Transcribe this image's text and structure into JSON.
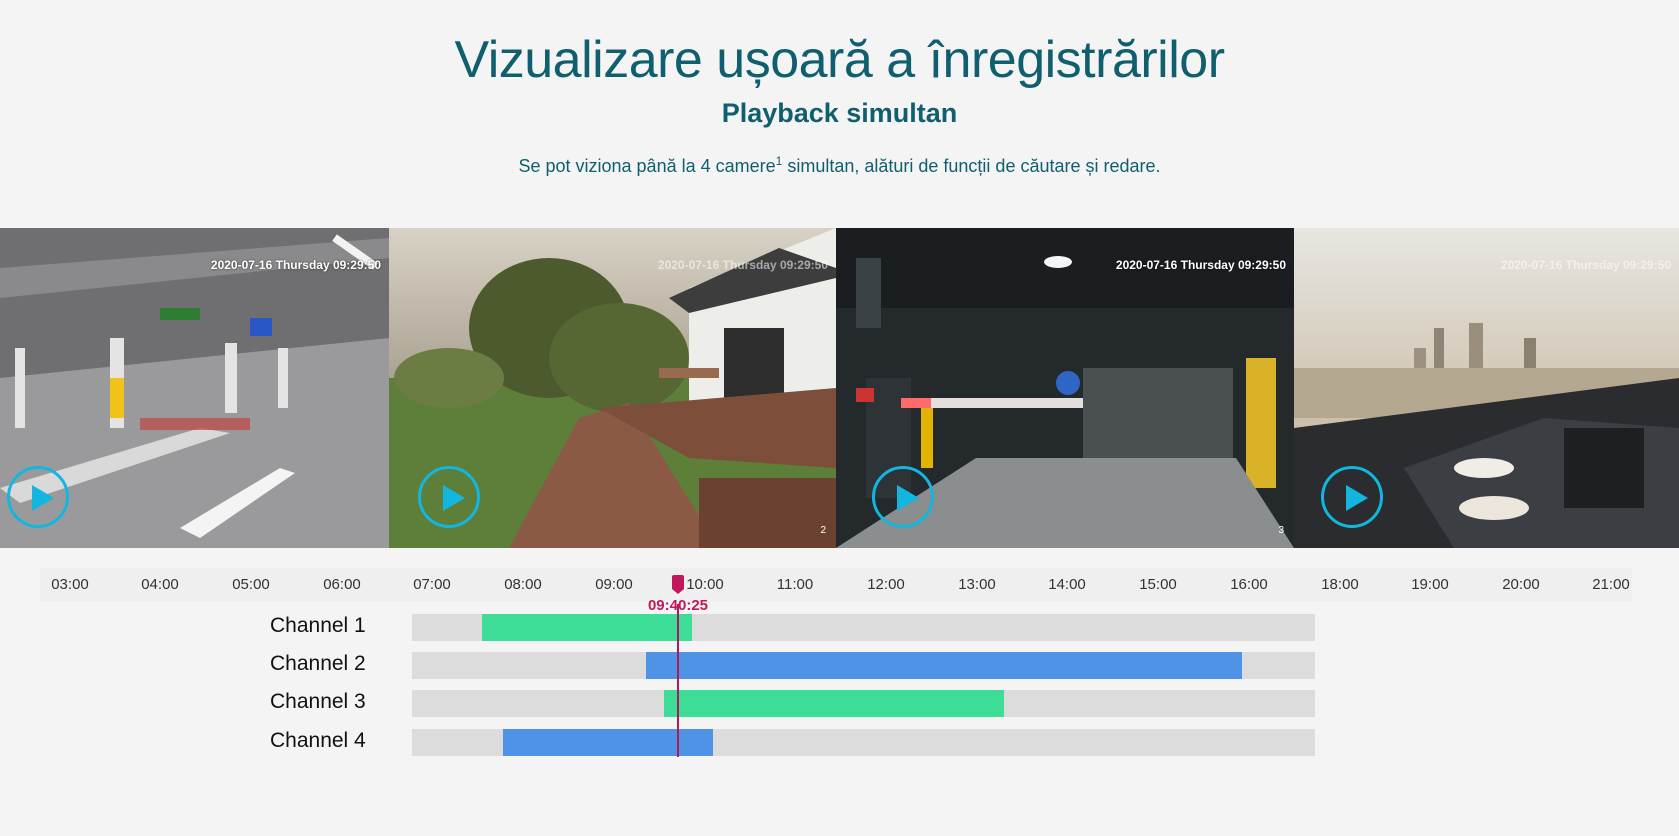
{
  "header": {
    "title": "Vizualizare ușoară a înregistrărilor",
    "subtitle": "Playback simultan",
    "desc_before": "Se pot viziona până la 4 camere",
    "desc_sup": "1",
    "desc_after": " simultan, alături de funcții de căutare și redare."
  },
  "cameras": [
    {
      "timestamp": "2020-07-16  Thursday 09:29:50",
      "number": ""
    },
    {
      "timestamp": "2020-07-16  Thursday 09:29:50",
      "number": "2"
    },
    {
      "timestamp": "2020-07-16  Thursday 09:29:50",
      "number": "3"
    },
    {
      "timestamp": "2020-07-16  Thursday 09:29:50",
      "number": ""
    }
  ],
  "timeline": {
    "ticks": [
      "03:00",
      "04:00",
      "05:00",
      "06:00",
      "07:00",
      "08:00",
      "09:00",
      "10:00",
      "11:00",
      "12:00",
      "13:00",
      "14:00",
      "15:00",
      "16:00",
      "18:00",
      "19:00",
      "20:00",
      "21:00"
    ],
    "current_time": "09:40:25",
    "channels": [
      {
        "label": "Channel 1",
        "color": "green"
      },
      {
        "label": "Channel 2",
        "color": "blue"
      },
      {
        "label": "Channel 3",
        "color": "green"
      },
      {
        "label": "Channel 4",
        "color": "blue"
      }
    ]
  },
  "colors": {
    "title": "#0f5f6e",
    "play_accent": "#12b6df",
    "marker": "#c2185b",
    "green_bar": "#3ddc97",
    "blue_bar": "#4f93e6",
    "track": "#dcdcdc"
  }
}
